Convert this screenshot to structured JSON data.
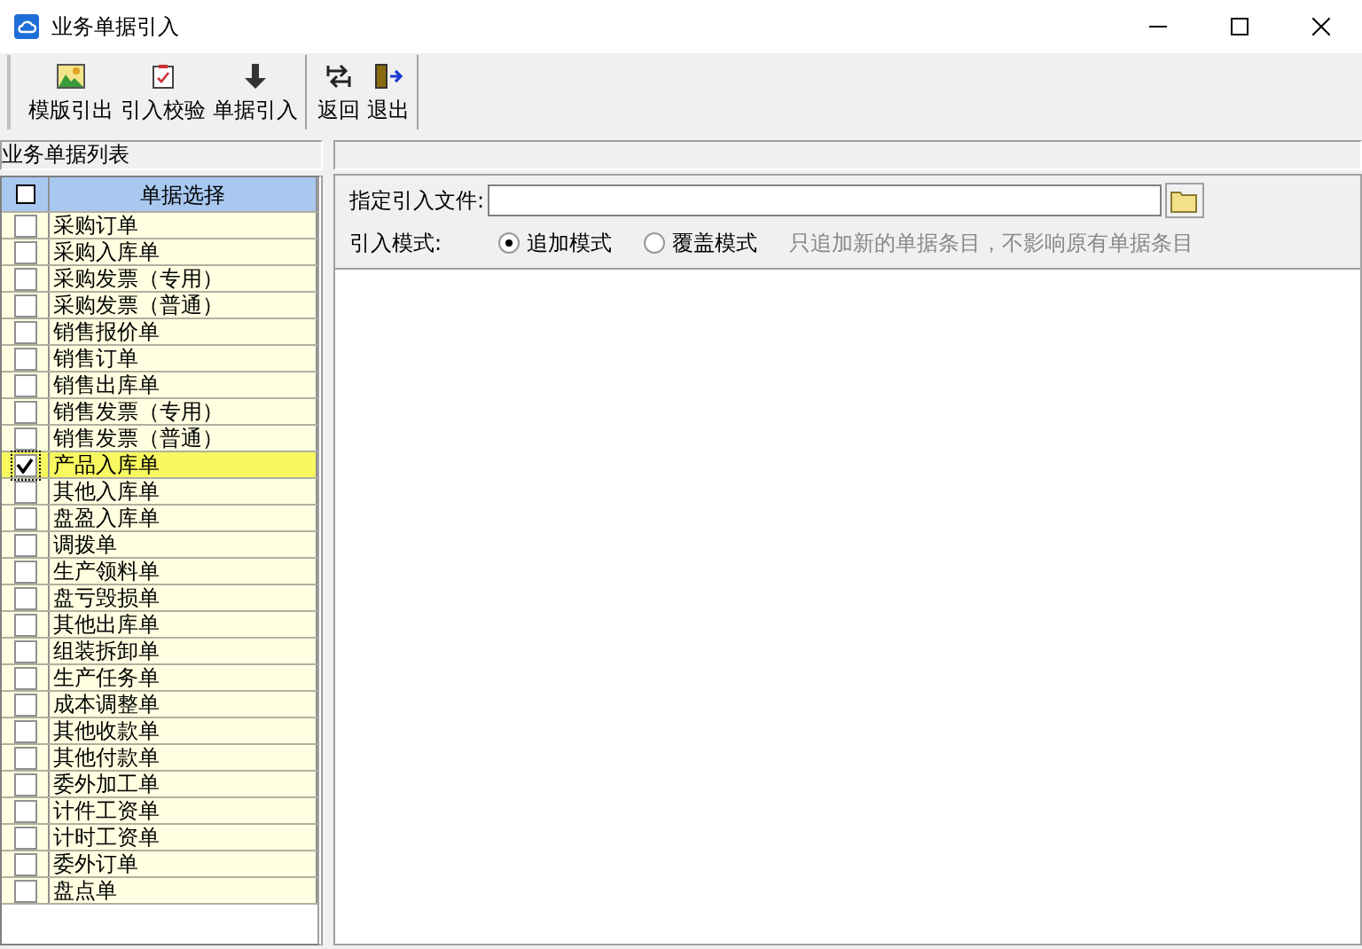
{
  "window": {
    "title": "业务单据引入"
  },
  "toolbar": [
    {
      "items": [
        {
          "label": "模版引出",
          "kind": "export"
        },
        {
          "label": "引入校验",
          "kind": "check"
        },
        {
          "label": "单据引入",
          "kind": "import"
        }
      ]
    },
    {
      "items": [
        {
          "label": "返回",
          "kind": "back"
        },
        {
          "label": "退出",
          "kind": "exit"
        }
      ]
    }
  ],
  "list_panel": {
    "title": "业务单据列表",
    "header_checked": false,
    "column": "单据选择",
    "rows": [
      {
        "label": "采购订单",
        "checked": false,
        "selected": false
      },
      {
        "label": "采购入库单",
        "checked": false,
        "selected": false
      },
      {
        "label": "采购发票（专用）",
        "checked": false,
        "selected": false
      },
      {
        "label": "采购发票（普通）",
        "checked": false,
        "selected": false
      },
      {
        "label": "销售报价单",
        "checked": false,
        "selected": false
      },
      {
        "label": "销售订单",
        "checked": false,
        "selected": false
      },
      {
        "label": "销售出库单",
        "checked": false,
        "selected": false
      },
      {
        "label": "销售发票（专用）",
        "checked": false,
        "selected": false
      },
      {
        "label": "销售发票（普通）",
        "checked": false,
        "selected": false
      },
      {
        "label": "产品入库单",
        "checked": true,
        "selected": true
      },
      {
        "label": "其他入库单",
        "checked": false,
        "selected": false
      },
      {
        "label": "盘盈入库单",
        "checked": false,
        "selected": false
      },
      {
        "label": "调拨单",
        "checked": false,
        "selected": false
      },
      {
        "label": "生产领料单",
        "checked": false,
        "selected": false
      },
      {
        "label": "盘亏毁损单",
        "checked": false,
        "selected": false
      },
      {
        "label": "其他出库单",
        "checked": false,
        "selected": false
      },
      {
        "label": "组装拆卸单",
        "checked": false,
        "selected": false
      },
      {
        "label": "生产任务单",
        "checked": false,
        "selected": false
      },
      {
        "label": "成本调整单",
        "checked": false,
        "selected": false
      },
      {
        "label": "其他收款单",
        "checked": false,
        "selected": false
      },
      {
        "label": "其他付款单",
        "checked": false,
        "selected": false
      },
      {
        "label": "委外加工单",
        "checked": false,
        "selected": false
      },
      {
        "label": "计件工资单",
        "checked": false,
        "selected": false
      },
      {
        "label": "计时工资单",
        "checked": false,
        "selected": false
      },
      {
        "label": "委外订单",
        "checked": false,
        "selected": false
      },
      {
        "label": "盘点单",
        "checked": false,
        "selected": false
      }
    ]
  },
  "import_form": {
    "file_label": "指定引入文件:",
    "mode_label": "引入模式:",
    "modes": [
      {
        "label": "追加模式",
        "selected": true
      },
      {
        "label": "覆盖模式",
        "selected": false
      }
    ],
    "hint": "只追加新的单据条目，不影响原有单据条目"
  }
}
